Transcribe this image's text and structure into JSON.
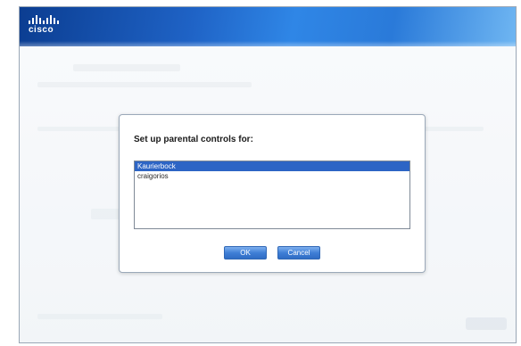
{
  "window": {
    "logo_text": "cisco"
  },
  "dialog": {
    "title": "Set up parental controls for:",
    "accounts": [
      {
        "label": "Kaurierbock",
        "selected": true
      },
      {
        "label": "craigorios",
        "selected": false
      }
    ],
    "ok_label": "OK",
    "cancel_label": "Cancel"
  },
  "colors": {
    "header_dark": "#0b3d91",
    "header_light": "#6fb6f2",
    "selection": "#2d65c5",
    "button": "#3f7fd6"
  }
}
